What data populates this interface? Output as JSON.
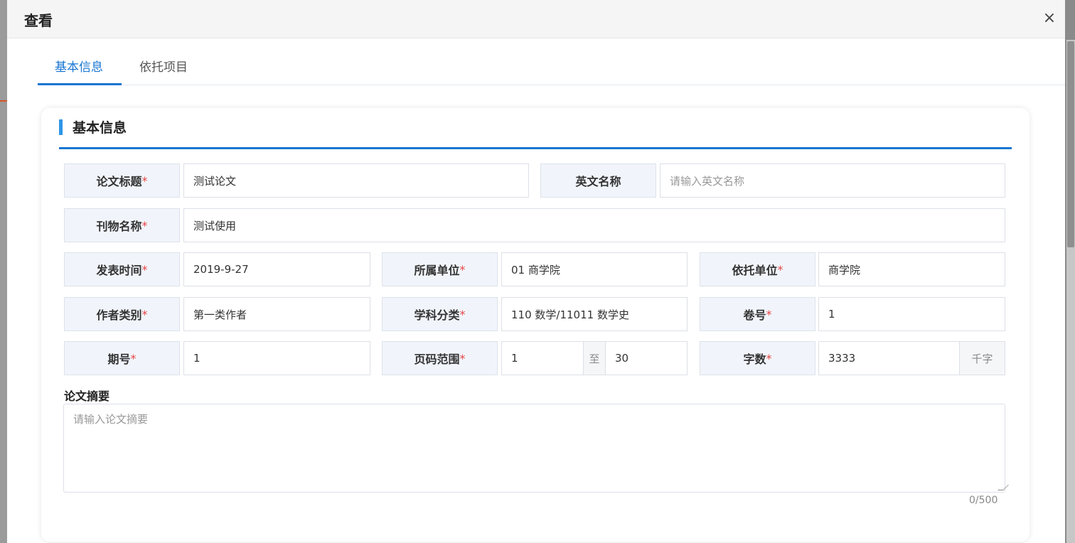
{
  "dialog": {
    "title": "查看",
    "close_glyph": "×"
  },
  "tabs": [
    {
      "label": "基本信息",
      "active": true
    },
    {
      "label": "依托项目",
      "active": false
    }
  ],
  "section": {
    "title": "基本信息"
  },
  "fields": {
    "paper_title": {
      "label": "论文标题",
      "value": "测试论文",
      "required": "*"
    },
    "english_name": {
      "label": "英文名称",
      "placeholder": "请输入英文名称"
    },
    "journal_name": {
      "label": "刊物名称",
      "value": "测试使用",
      "required": "*"
    },
    "publish_time": {
      "label": "发表时间",
      "value": "2019-9-27",
      "required": "*"
    },
    "department": {
      "label": "所属单位",
      "value": "01 商学院",
      "required": "*"
    },
    "host_unit": {
      "label": "依托单位",
      "value": "商学院",
      "required": "*"
    },
    "author_type": {
      "label": "作者类别",
      "value": "第一类作者",
      "required": "*"
    },
    "subject": {
      "label": "学科分类",
      "value": "110 数学/11011 数学史",
      "required": "*"
    },
    "volume": {
      "label": "卷号",
      "value": "1",
      "required": "*"
    },
    "issue": {
      "label": "期号",
      "value": "1",
      "required": "*"
    },
    "page_range": {
      "label": "页码范围",
      "from": "1",
      "separator": "至",
      "to": "30",
      "required": "*"
    },
    "word_count": {
      "label": "字数",
      "value": "3333",
      "unit": "千字",
      "required": "*"
    }
  },
  "abstract": {
    "label": "论文摘要",
    "placeholder": "请输入论文摘要",
    "counter": "0/500"
  },
  "colors": {
    "accent": "#1976d2",
    "required": "#e64545",
    "label_bg": "#f1f5fb"
  },
  "icons": {
    "close": "close-icon",
    "resize": "resize-grip-icon"
  }
}
